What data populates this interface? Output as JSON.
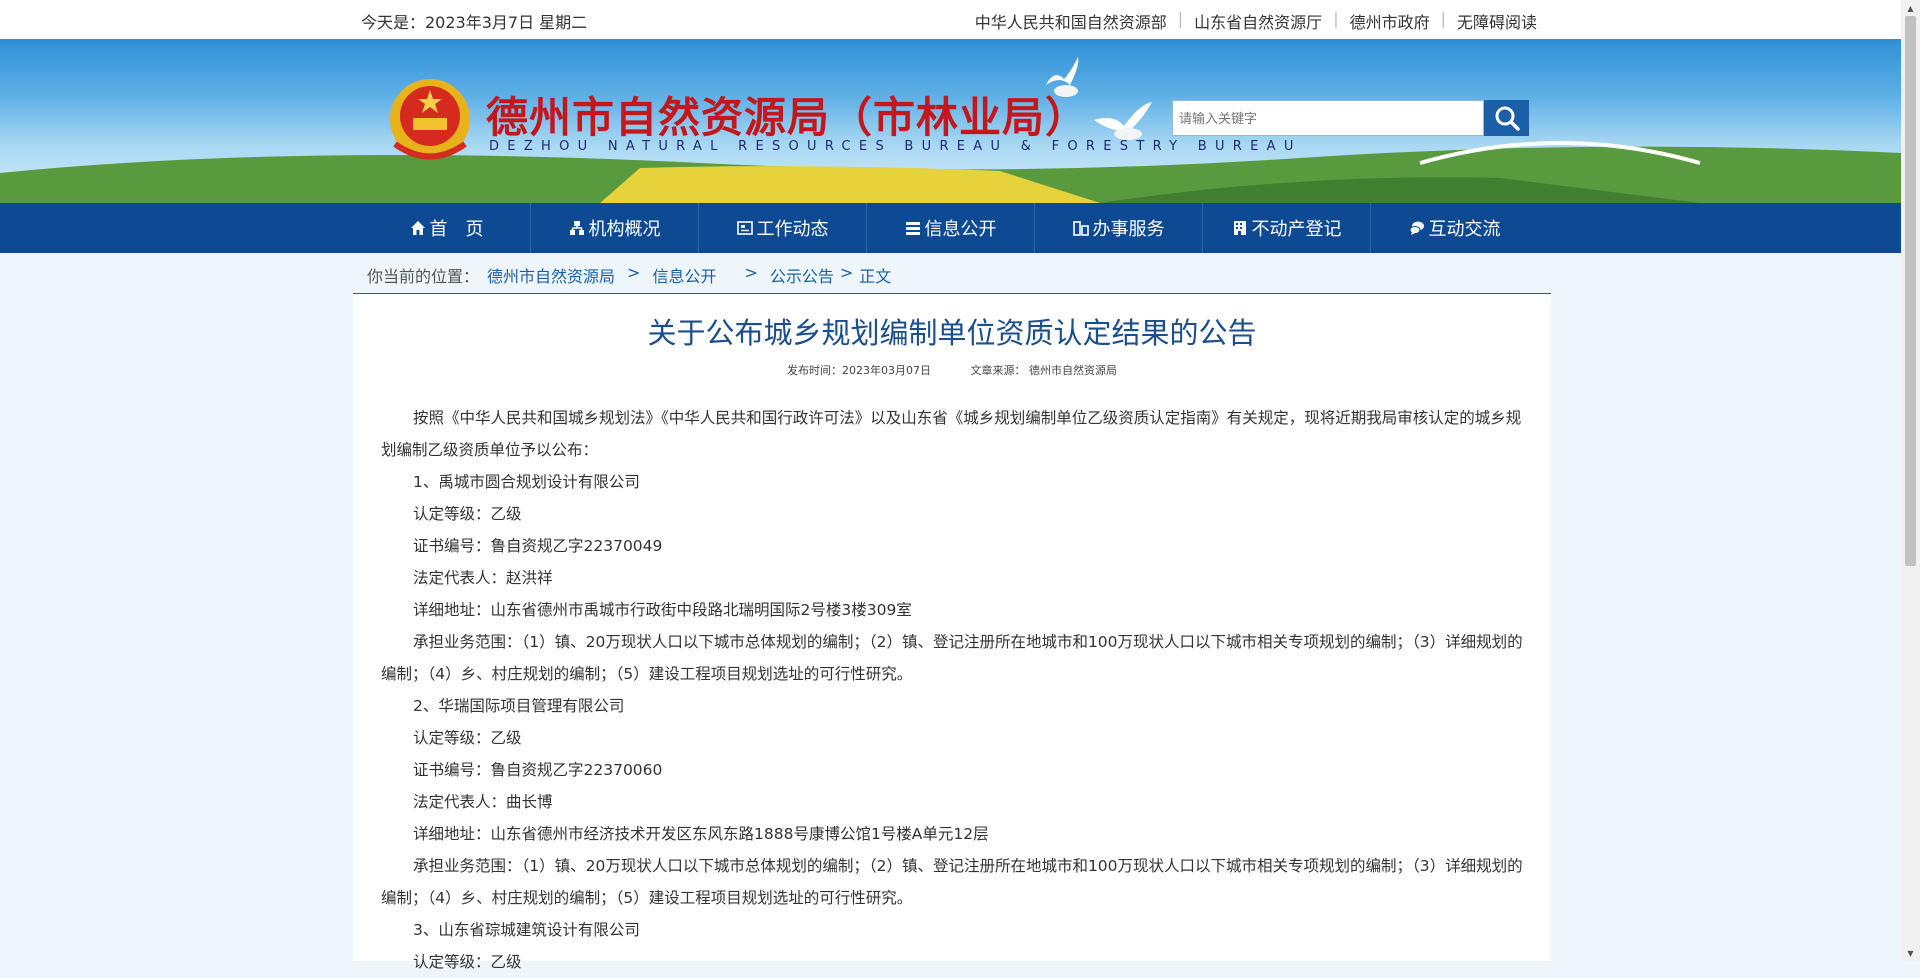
{
  "topbar": {
    "date": "今天是：2023年3月7日 星期二",
    "links": [
      "中华人民共和国自然资源部",
      "山东省自然资源厅",
      "德州市政府",
      "无障碍阅读"
    ]
  },
  "header": {
    "title": "德州市自然资源局（市林业局）",
    "subtitle": "DEZHOU NATURAL RESOURCES BUREAU & FORESTRY BUREAU",
    "search_placeholder": "请输入关键字"
  },
  "nav": [
    {
      "label": "首　页",
      "icon": "home-icon"
    },
    {
      "label": "机构概况",
      "icon": "org-icon"
    },
    {
      "label": "工作动态",
      "icon": "news-icon"
    },
    {
      "label": "信息公开",
      "icon": "list-icon"
    },
    {
      "label": "办事服务",
      "icon": "service-icon"
    },
    {
      "label": "不动产登记",
      "icon": "building-icon"
    },
    {
      "label": "互动交流",
      "icon": "chat-icon"
    }
  ],
  "breadcrumb": {
    "prefix": "你当前的位置：",
    "items": [
      "德州市自然资源局",
      "信息公开",
      "公示公告",
      "正文"
    ]
  },
  "article": {
    "title": "关于公布城乡规划编制单位资质认定结果的公告",
    "publish_time": "发布时间：2023年03月07日",
    "source": "文章来源：  德州市自然资源局",
    "paragraphs": [
      "按照《中华人民共和国城乡规划法》《中华人民共和国行政许可法》以及山东省《城乡规划编制单位乙级资质认定指南》有关规定，现将近期我局审核认定的城乡规划编制乙级资质单位予以公布：",
      "1、禹城市圆合规划设计有限公司",
      "认定等级：乙级",
      "证书编号：鲁自资规乙字22370049",
      "法定代表人：赵洪祥",
      "详细地址：山东省德州市禹城市行政街中段路北瑞明国际2号楼3楼309室",
      "承担业务范围：（1）镇、20万现状人口以下城市总体规划的编制；（2）镇、登记注册所在地城市和100万现状人口以下城市相关专项规划的编制；（3）详细规划的编制；（4）乡、村庄规划的编制；（5）建设工程项目规划选址的可行性研究。",
      "2、华瑞国际项目管理有限公司",
      "认定等级：乙级",
      "证书编号：鲁自资规乙字22370060",
      "法定代表人：曲长博",
      "详细地址：山东省德州市经济技术开发区东风东路1888号康博公馆1号楼A单元12层",
      "承担业务范围：（1）镇、20万现状人口以下城市总体规划的编制；（2）镇、登记注册所在地城市和100万现状人口以下城市相关专项规划的编制；（3）详细规划的编制；（4）乡、村庄规划的编制；（5）建设工程项目规划选址的可行性研究。",
      "3、山东省琮城建筑设计有限公司",
      "认定等级：乙级"
    ]
  },
  "colors": {
    "nav_bg": "#0e4a94",
    "title_red": "#c4171c",
    "link_blue": "#1a5fa8"
  }
}
